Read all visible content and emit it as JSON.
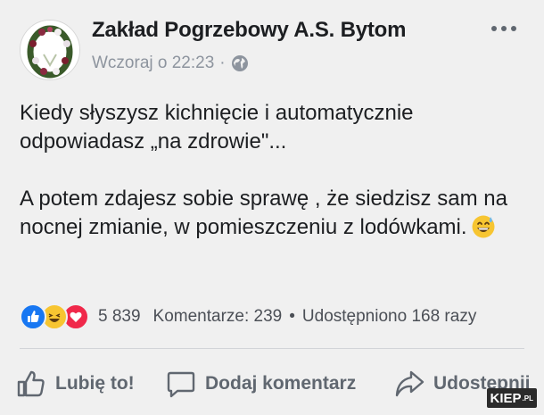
{
  "post": {
    "page_name": "Zakład Pogrzebowy A.S. Bytom",
    "timestamp": "Wczoraj o 22:23",
    "meta_separator": "·",
    "privacy_icon": "globe-icon",
    "paragraph1": "Kiedy słyszysz kichnięcie i automatycznie odpowiadasz „na zdrowie\"...",
    "paragraph2": "A potem zdajesz sobie sprawę , że siedzisz sam na nocnej zmianie, w pomieszczeniu z lodówkami.",
    "emoji": "grinning-sweat-emoji"
  },
  "reactions": {
    "icons": [
      "like-reaction-icon",
      "haha-reaction-icon",
      "love-reaction-icon"
    ],
    "count": "5 839",
    "comments": "Komentarze: 239",
    "separator": "•",
    "shares": "Udostępniono 168 razy"
  },
  "actions": {
    "like": "Lubię to!",
    "comment": "Dodaj komentarz",
    "share": "Udostępnij"
  },
  "watermark": {
    "text": "KIEP",
    "suffix": ".PL"
  },
  "colors": {
    "background": "#f0f0f0",
    "text": "#1c1e21",
    "muted": "#8d949e",
    "like": "#1877f2",
    "haha": "#f7c531",
    "love": "#f0284a"
  }
}
